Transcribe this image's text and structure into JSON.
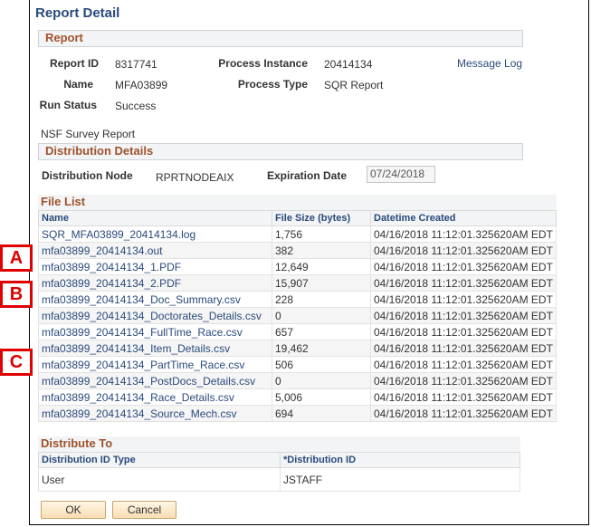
{
  "page": {
    "title": "Report Detail"
  },
  "report": {
    "section_title": "Report",
    "report_id_label": "Report ID",
    "report_id": "8317741",
    "process_instance_label": "Process Instance",
    "process_instance": "20414134",
    "message_log_link": "Message Log",
    "name_label": "Name",
    "name": "MFA03899",
    "process_type_label": "Process Type",
    "process_type": "SQR Report",
    "run_status_label": "Run Status",
    "run_status": "Success",
    "description": "NSF Survey Report"
  },
  "distribution": {
    "section_title": "Distribution Details",
    "node_label": "Distribution Node",
    "node": "RPRTNODEAIX",
    "expiration_label": "Expiration Date",
    "expiration": "07/24/2018"
  },
  "file_list": {
    "title": "File List",
    "columns": [
      "Name",
      "File Size (bytes)",
      "Datetime Created"
    ],
    "rows": [
      {
        "name": "SQR_MFA03899_20414134.log",
        "size": "1,756",
        "created": "04/16/2018 11:12:01.325620AM EDT"
      },
      {
        "name": "mfa03899_20414134.out",
        "size": "382",
        "created": "04/16/2018 11:12:01.325620AM EDT"
      },
      {
        "name": "mfa03899_20414134_1.PDF",
        "size": "12,649",
        "created": "04/16/2018 11:12:01.325620AM EDT"
      },
      {
        "name": "mfa03899_20414134_2.PDF",
        "size": "15,907",
        "created": "04/16/2018 11:12:01.325620AM EDT"
      },
      {
        "name": "mfa03899_20414134_Doc_Summary.csv",
        "size": "228",
        "created": "04/16/2018 11:12:01.325620AM EDT"
      },
      {
        "name": "mfa03899_20414134_Doctorates_Details.csv",
        "size": "0",
        "created": "04/16/2018 11:12:01.325620AM EDT"
      },
      {
        "name": "mfa03899_20414134_FullTime_Race.csv",
        "size": "657",
        "created": "04/16/2018 11:12:01.325620AM EDT"
      },
      {
        "name": "mfa03899_20414134_Item_Details.csv",
        "size": "19,462",
        "created": "04/16/2018 11:12:01.325620AM EDT"
      },
      {
        "name": "mfa03899_20414134_PartTime_Race.csv",
        "size": "506",
        "created": "04/16/2018 11:12:01.325620AM EDT"
      },
      {
        "name": "mfa03899_20414134_PostDocs_Details.csv",
        "size": "0",
        "created": "04/16/2018 11:12:01.325620AM EDT"
      },
      {
        "name": "mfa03899_20414134_Race_Details.csv",
        "size": "5,006",
        "created": "04/16/2018 11:12:01.325620AM EDT"
      },
      {
        "name": "mfa03899_20414134_Source_Mech.csv",
        "size": "694",
        "created": "04/16/2018 11:12:01.325620AM EDT"
      }
    ]
  },
  "distribute_to": {
    "title": "Distribute To",
    "columns": [
      "Distribution ID Type",
      "*Distribution ID"
    ],
    "rows": [
      {
        "type": "User",
        "id": "JSTAFF"
      }
    ]
  },
  "buttons": {
    "ok": "OK",
    "cancel": "Cancel"
  },
  "markers": [
    "A",
    "B",
    "C"
  ]
}
